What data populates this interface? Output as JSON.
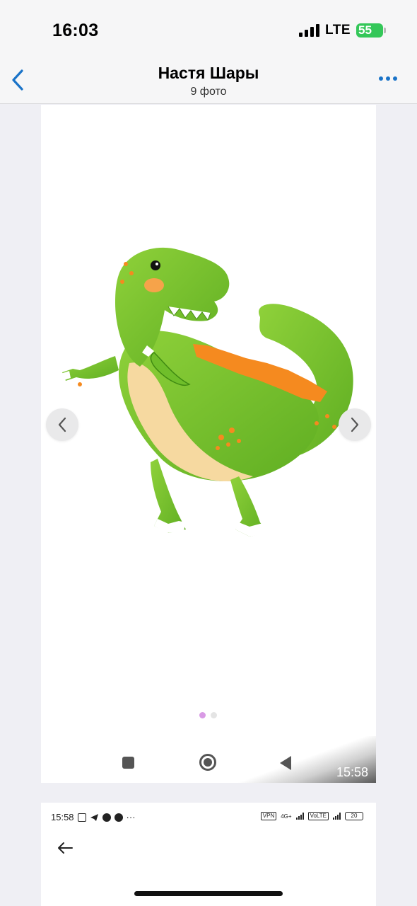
{
  "status_bar": {
    "time": "16:03",
    "network": "LTE",
    "battery_level": "55"
  },
  "nav": {
    "back_icon": "chevron-left-icon",
    "title": "Настя Шары",
    "subtitle": "9 фото",
    "more_icon": "ellipsis-icon",
    "accent_color": "#1a73c8"
  },
  "photo": {
    "subject": "dinosaur-balloon-image",
    "prev_icon": "chevron-left-icon",
    "next_icon": "chevron-right-icon",
    "pager": {
      "total": 2,
      "active": 1,
      "active_color": "#d99ae5"
    }
  },
  "embedded_android_nav": {
    "recent_icon": "square-icon",
    "home_icon": "circle-icon",
    "back_icon": "triangle-back-icon",
    "time": "15:58"
  },
  "second_screenshot": {
    "time": "15:58",
    "status_labels": {
      "vpn": "VPN",
      "network": "4G+",
      "volte": "VoLTE",
      "battery": "20"
    },
    "back_icon": "arrow-left-icon"
  }
}
